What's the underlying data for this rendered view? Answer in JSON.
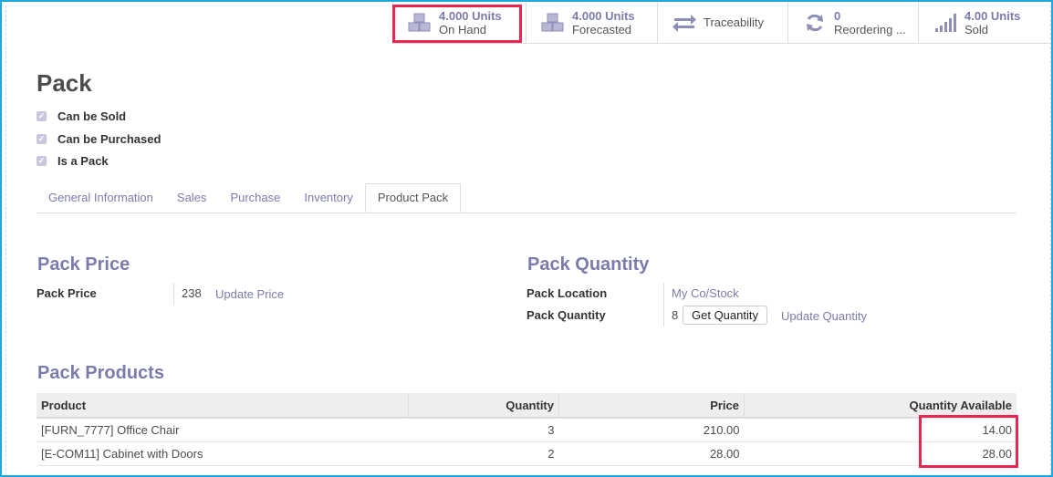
{
  "smart_buttons": [
    {
      "value": "4.000 Units",
      "label": "On Hand",
      "icon": "cubes-icon"
    },
    {
      "value": "4.000 Units",
      "label": "Forecasted",
      "icon": "cubes-icon"
    },
    {
      "value": "",
      "label": "Traceability",
      "icon": "exchange-icon"
    },
    {
      "value": "0",
      "label": "Reordering ...",
      "icon": "refresh-icon"
    },
    {
      "value": "4.00 Units",
      "label": "Sold",
      "icon": "signal-icon"
    }
  ],
  "title": "Pack",
  "checkboxes": [
    {
      "label": "Can be Sold",
      "checked": true
    },
    {
      "label": "Can be Purchased",
      "checked": true
    },
    {
      "label": "Is a Pack",
      "checked": true
    }
  ],
  "tabs": [
    "General Information",
    "Sales",
    "Purchase",
    "Inventory",
    "Product Pack"
  ],
  "active_tab": "Product Pack",
  "pack_price": {
    "heading": "Pack Price",
    "label": "Pack Price",
    "value": "238",
    "link": "Update Price"
  },
  "pack_quantity": {
    "heading": "Pack Quantity",
    "location_label": "Pack Location",
    "location_value": "My Co/Stock",
    "quantity_label": "Pack Quantity",
    "quantity_value": "8",
    "get_button": "Get Quantity",
    "update_link": "Update Quantity"
  },
  "pack_products": {
    "heading": "Pack Products",
    "columns": [
      "Product",
      "Quantity",
      "Price",
      "Quantity Available"
    ],
    "rows": [
      [
        "[FURN_7777] Office Chair",
        "3",
        "210.00",
        "14.00"
      ],
      [
        "[E-COM11] Cabinet with Doors",
        "2",
        "28.00",
        "28.00"
      ]
    ]
  },
  "colors": {
    "accent": "#7c7bad",
    "highlight": "#e8264f",
    "frame": "#1fa8e0"
  }
}
